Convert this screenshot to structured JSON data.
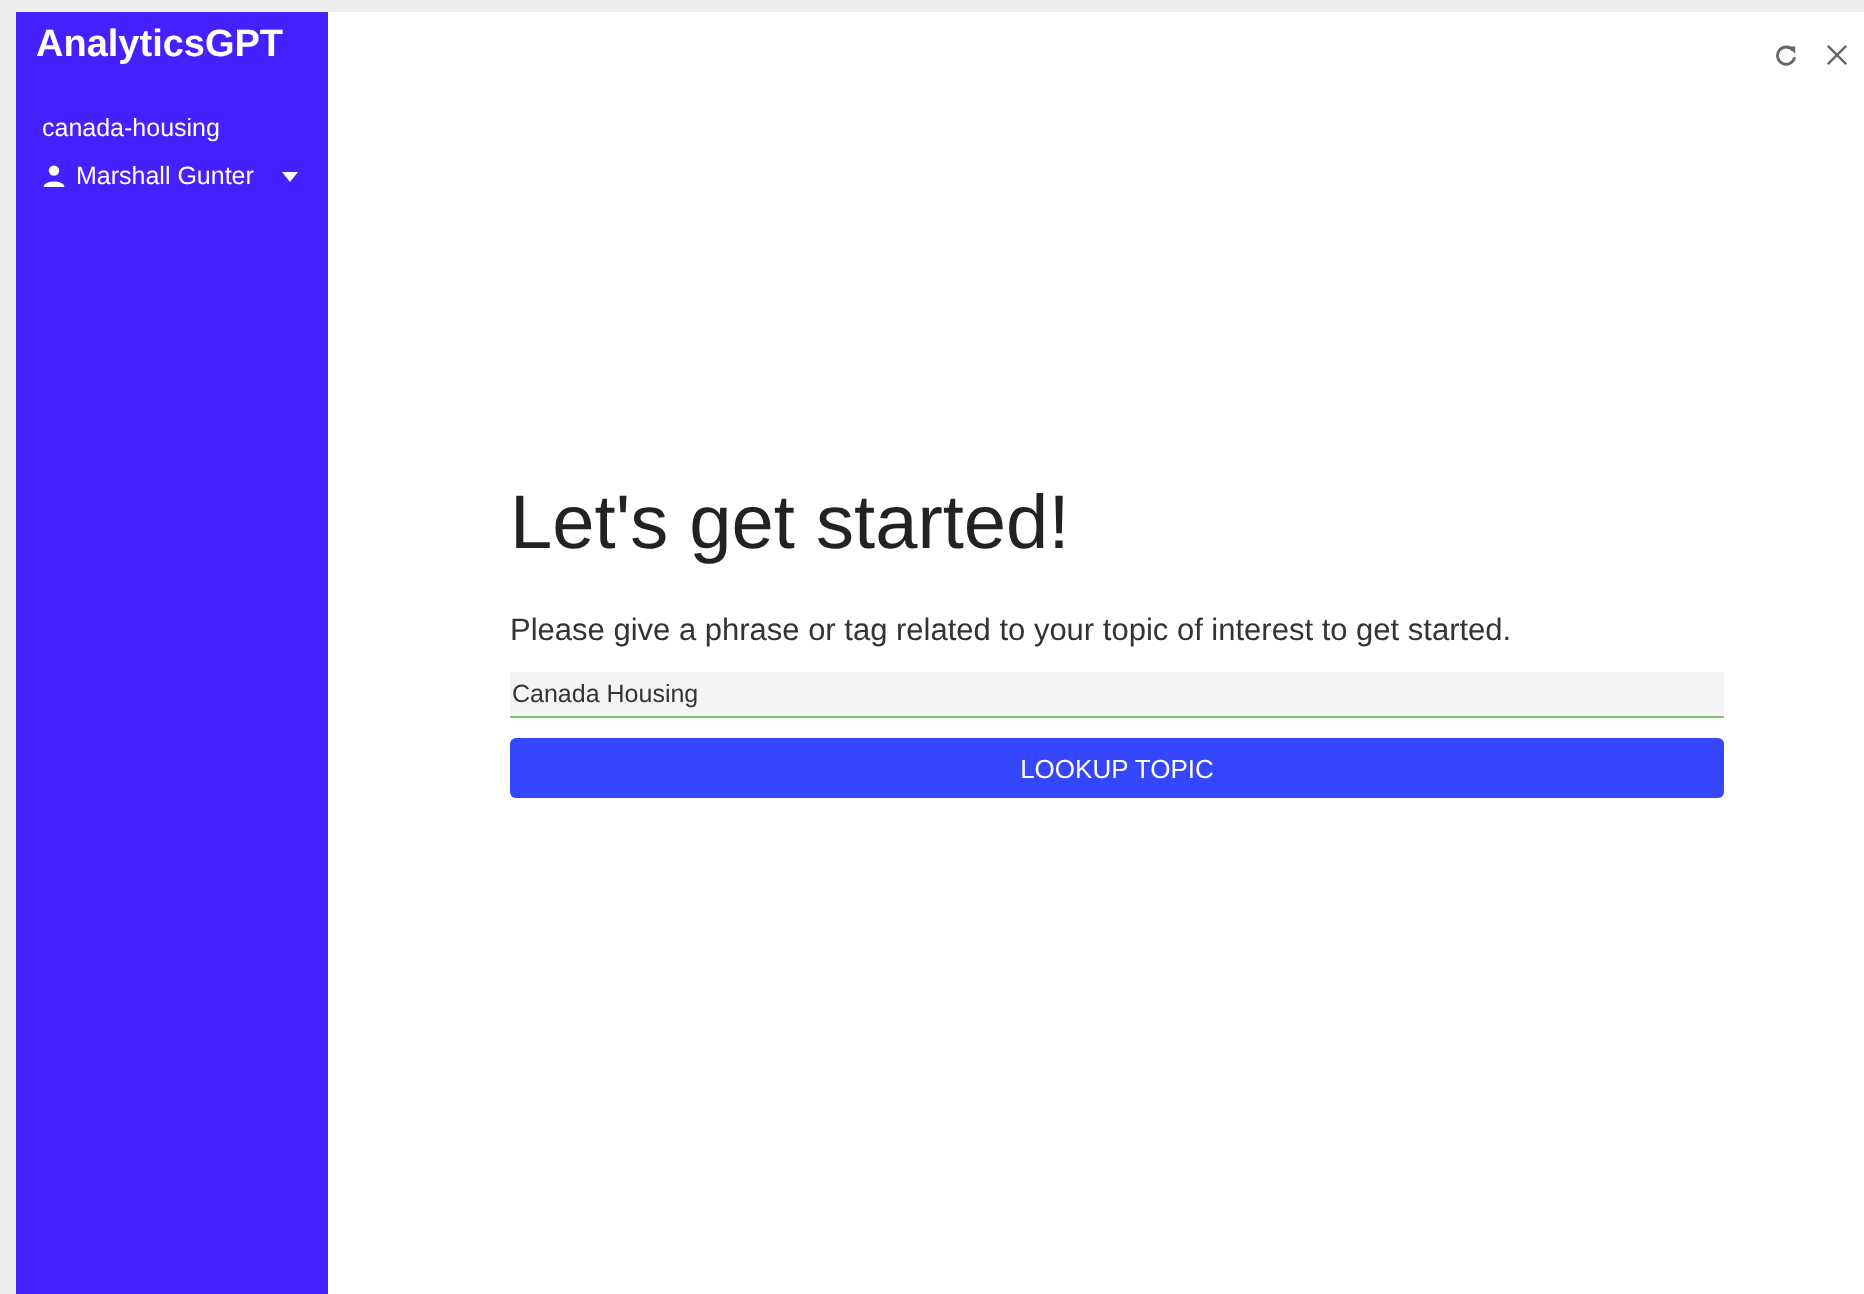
{
  "sidebar": {
    "logo": "AnalyticsGPT",
    "project": "canada-housing",
    "user": {
      "name": "Marshall Gunter",
      "expanded": false
    }
  },
  "toolbar": {
    "buttons": [
      {
        "kind": "refresh"
      },
      {
        "kind": "close"
      }
    ]
  },
  "main": {
    "heading": "Let's get started!",
    "prompt": "Please give a phrase or tag related to your topic of interest to get started.",
    "topic_field": {
      "value": "Canada Housing"
    },
    "submit": "LOOKUP TOPIC"
  }
}
